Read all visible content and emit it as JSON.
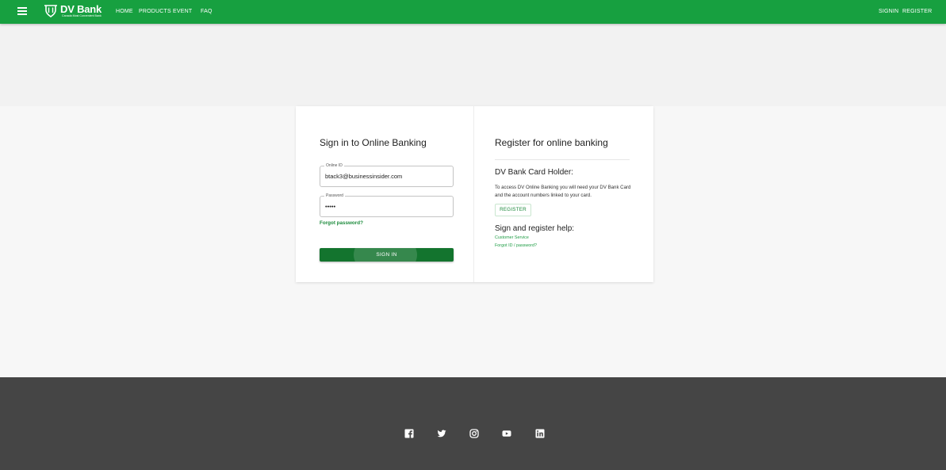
{
  "header": {
    "logo_name": "DV Bank",
    "logo_tagline": "Canada Most Convenient Bank",
    "nav": [
      "HOME",
      "PRODUCTS",
      "EVENT",
      "FAQ"
    ],
    "signin": "SIGNIN",
    "register": "REGISTER",
    "bar_color": "#17a040"
  },
  "signin": {
    "title": "Sign in to Online Banking",
    "online_id_label": "Online ID",
    "online_id_value": "btack3@businessinsider.com",
    "password_label": "Password",
    "password_value": "•••••",
    "forgot_password": "Forgot password?",
    "button": "SIGN IN"
  },
  "register": {
    "title": "Register for online banking",
    "card_holder_title": "DV Bank Card Holder:",
    "description": "To access DV Online Banking you will need your DV Bank Card and the account numbers linked to your card.",
    "button": "REGISTER",
    "help_title": "Sign and register help:",
    "help_links": [
      "Customer Service",
      "Forgot ID / password?"
    ]
  },
  "footer": {
    "icons": [
      "facebook-icon",
      "twitter-icon",
      "instagram-icon",
      "youtube-icon",
      "linkedin-icon"
    ]
  }
}
